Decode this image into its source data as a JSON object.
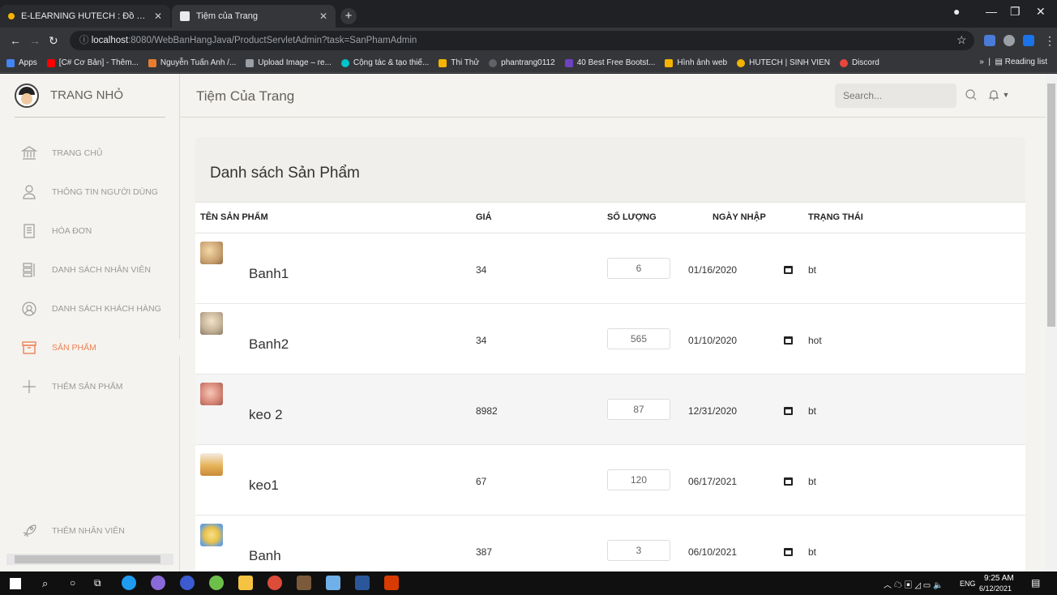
{
  "browser": {
    "tabs": [
      {
        "title": "E-LEARNING HUTECH : Đồ án java",
        "active": false,
        "favicon_color": "#f5b400"
      },
      {
        "title": "Tiệm của Trang",
        "active": true,
        "favicon_color": "#e8eaed"
      }
    ],
    "url_host": "localhost",
    "url_rest": ":8080/WebBanHangJava/ProductServletAdmin?task=SanPhamAdmin",
    "bookmarks": [
      {
        "label": "Apps",
        "color": "#4285f4"
      },
      {
        "label": "[C# Cơ Bản] - Thêm...",
        "color": "#ff0000"
      },
      {
        "label": "Nguyễn Tuấn Anh /...",
        "color": "#e97d2f"
      },
      {
        "label": "Upload Image – re...",
        "color": "#9aa0a6"
      },
      {
        "label": "Cộng tác & tạo thiế...",
        "color": "#00c4cc"
      },
      {
        "label": "Thi Thử",
        "color": "#f5b400"
      },
      {
        "label": "phantrang0112",
        "color": "#5f6368"
      },
      {
        "label": "40 Best Free Bootst...",
        "color": "#6f42c1"
      },
      {
        "label": "Hình ảnh web",
        "color": "#f5b400"
      },
      {
        "label": "HUTECH | SINH VIEN",
        "color": "#f5b400"
      },
      {
        "label": "Discord",
        "color": "#e8453c"
      }
    ],
    "reading_list": "Reading list"
  },
  "sidebar": {
    "brand": "TRANG NHỎ",
    "items": [
      {
        "label": "TRANG CHỦ",
        "icon": "bank-icon",
        "active": false
      },
      {
        "label": "THÔNG TIN NGƯỜI DÙNG",
        "icon": "user-icon",
        "active": false
      },
      {
        "label": "HÓA ĐƠN",
        "icon": "paper-icon",
        "active": false
      },
      {
        "label": "DANH SÁCH NHÂN VIÊN",
        "icon": "list-icon",
        "active": false
      },
      {
        "label": "DANH SÁCH KHÁCH HÀNG",
        "icon": "at-icon",
        "active": false
      },
      {
        "label": "SẢN PHẨM",
        "icon": "box-icon",
        "active": true
      },
      {
        "label": "THÊM SẢN PHẨM",
        "icon": "plus-icon",
        "active": false
      }
    ],
    "footer_item": {
      "label": "THÊM NHÂN VIÊN",
      "icon": "spaceship-icon"
    }
  },
  "header": {
    "title": "Tiệm Của Trang",
    "search_placeholder": "Search..."
  },
  "products": {
    "title": "Danh sách Sản Phẩm",
    "columns": [
      "TÊN SẢN PHẨM",
      "GIÁ",
      "SỐ LƯỢNG",
      "NGÀY NHẬP",
      "TRẠNG THÁI"
    ],
    "rows": [
      {
        "name": "Banh1",
        "price": "34",
        "qty": "6",
        "date": "01/16/2020",
        "status": "bt",
        "thumb": "#c9a070"
      },
      {
        "name": "Banh2",
        "price": "34",
        "qty": "565",
        "date": "01/10/2020",
        "status": "hot",
        "thumb": "#c7b59a"
      },
      {
        "name": "keo 2",
        "price": "8982",
        "qty": "87",
        "date": "12/31/2020",
        "status": "bt",
        "thumb": "#d98a7a"
      },
      {
        "name": "keo1",
        "price": "67",
        "qty": "120",
        "date": "06/17/2021",
        "status": "bt",
        "thumb": "#e6b35a"
      },
      {
        "name": "Banh",
        "price": "387",
        "qty": "3",
        "date": "06/10/2021",
        "status": "bt",
        "thumb": "#e9c24c"
      }
    ]
  },
  "taskbar": {
    "time": "9:25 AM",
    "date": "6/12/2021",
    "lang": "ENG"
  },
  "colors": {
    "accent": "#ef8157",
    "info": "#51bcda"
  }
}
